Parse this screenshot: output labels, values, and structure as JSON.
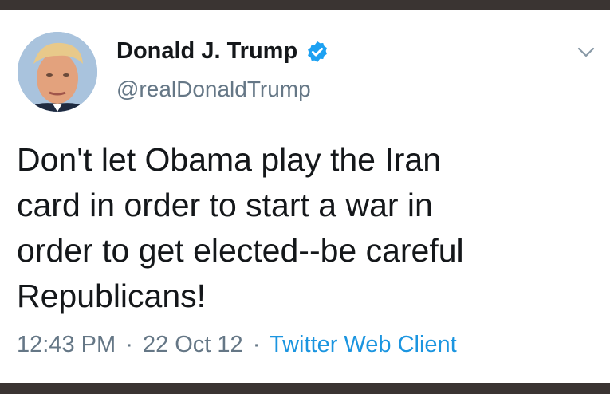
{
  "author": {
    "display_name": "Donald J. Trump",
    "handle": "@realDonaldTrump",
    "verified": true,
    "avatar_icon": "profile-photo",
    "verified_icon": "verified-badge-icon",
    "verified_color": "#1da1f2"
  },
  "tweet": {
    "text_lines": [
      "Don't let Obama play the Iran",
      "card in order to start a war in",
      "order to get elected--be careful",
      "Republicans!"
    ]
  },
  "meta": {
    "time": "12:43 PM",
    "separator": "·",
    "date": "22 Oct 12",
    "client": "Twitter Web Client",
    "client_color": "#1b95e0"
  },
  "menu": {
    "icon": "chevron-down-icon"
  }
}
